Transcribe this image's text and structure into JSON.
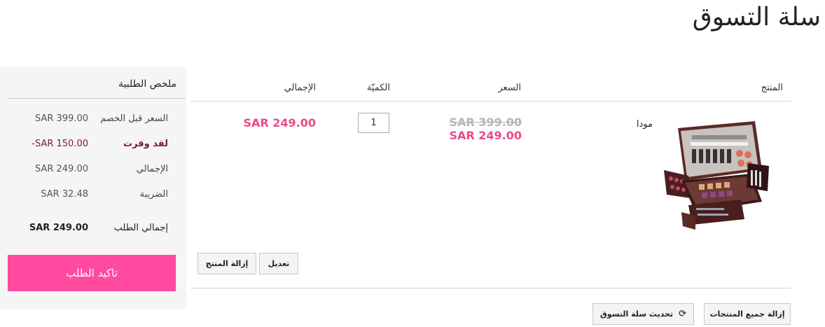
{
  "page": {
    "title": "سلة التسوق"
  },
  "summary": {
    "title": "ملخص الطلبية",
    "rows": [
      {
        "label": "السعر قبل الخصم",
        "value": "SAR 399.00"
      },
      {
        "label": "لقد وفرت",
        "value": "-SAR 150.00"
      },
      {
        "label": "الإجمالي",
        "value": "SAR 249.00"
      },
      {
        "label": "الضريبة",
        "value": "SAR 32.48"
      },
      {
        "label": "إجمالي الطلب",
        "value": "SAR 249.00"
      }
    ],
    "checkout_label": "تاكيد الطلب"
  },
  "table": {
    "headers": {
      "product": "المنتج",
      "price": "السعر",
      "quantity": "الكميّة",
      "total": "الإجمالي"
    },
    "items": [
      {
        "name": "مودا",
        "image_icon": "makeup-palette-case",
        "price_original": "SAR 399.00",
        "price_sale": "SAR 249.00",
        "quantity": "1",
        "line_total": "SAR 249.00",
        "edit_label": "تعديل",
        "remove_label": "إزالة المنتج"
      }
    ]
  },
  "actions": {
    "update_cart_label": "تحديث سلة التسوق",
    "update_icon": "refresh-icon",
    "clear_cart_label": "إزالة جميع المنتجات"
  },
  "colors": {
    "accent": "#ff4aa0",
    "sale_price": "#ec4a8c",
    "saved": "#7a1a2e",
    "panel_bg": "#f5f5f5"
  }
}
